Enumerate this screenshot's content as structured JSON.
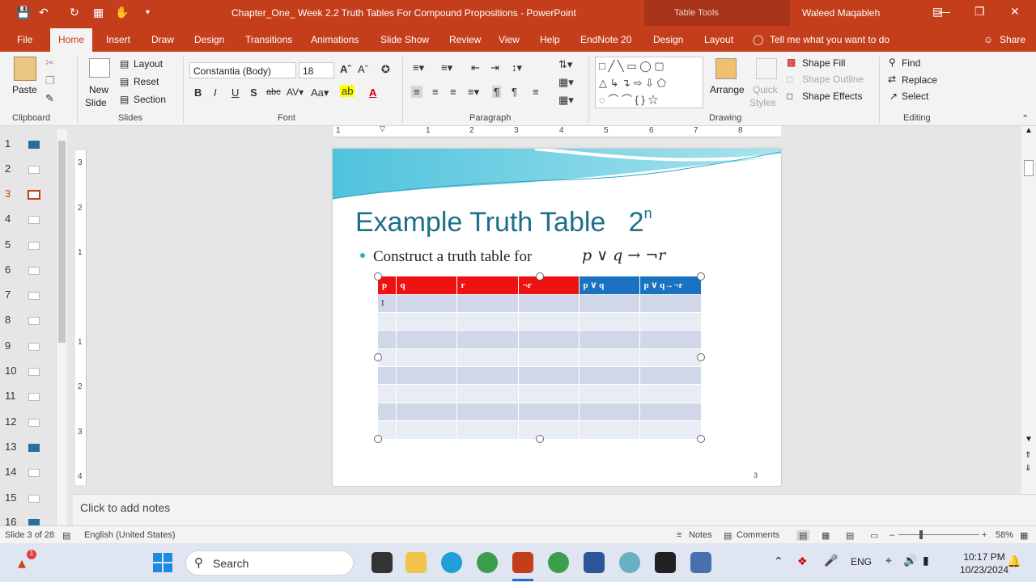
{
  "window": {
    "title": "Chapter_One_ Week 2.2 Truth Tables For Compound Propositions - PowerPoint",
    "context_label": "Table Tools",
    "user": "Waleed Maqableh",
    "share": "Share"
  },
  "tabs": [
    "File",
    "Home",
    "Insert",
    "Draw",
    "Design",
    "Transitions",
    "Animations",
    "Slide Show",
    "Review",
    "View",
    "Help",
    "EndNote 20",
    "Design",
    "Layout"
  ],
  "active_tab": "Home",
  "tell_me": "Tell me what you want to do",
  "ribbon": {
    "clipboard": {
      "paste": "Paste",
      "label": "Clipboard"
    },
    "slides": {
      "new_slide_1": "New",
      "new_slide_2": "Slide",
      "layout": "Layout",
      "reset": "Reset",
      "section": "Section",
      "label": "Slides"
    },
    "font": {
      "name": "Constantia (Body)",
      "size": "18",
      "label": "Font"
    },
    "paragraph": {
      "label": "Paragraph"
    },
    "drawing": {
      "arrange": "Arrange",
      "quick_1": "Quick",
      "quick_2": "Styles",
      "shape_fill": "Shape Fill",
      "shape_outline": "Shape Outline",
      "shape_effects": "Shape Effects",
      "label": "Drawing"
    },
    "editing": {
      "find": "Find",
      "replace": "Replace",
      "select": "Select",
      "label": "Editing"
    }
  },
  "thumbnails": [
    "1",
    "2",
    "3",
    "4",
    "5",
    "6",
    "7",
    "8",
    "9",
    "10",
    "11",
    "12",
    "13",
    "14",
    "15",
    "16"
  ],
  "active_slide": "3",
  "ruler": {
    "h_ticks": [
      "1",
      "1",
      "2",
      "3",
      "4",
      "5",
      "6",
      "7",
      "8"
    ],
    "v_ticks": [
      "3",
      "2",
      "1",
      "1",
      "2",
      "3",
      "4"
    ]
  },
  "slide": {
    "title": "Example Truth Table",
    "title_power": "2",
    "title_exp": "n",
    "bullet": "Construct a truth table for",
    "formula": "p ∨ q → ¬r",
    "number": "3",
    "table": {
      "headers": [
        "p",
        "q",
        "r",
        "¬r",
        "p ∨ q",
        "p ∨ q→¬r"
      ],
      "rows": [
        [
          "1",
          "",
          "",
          "",
          "",
          ""
        ],
        [
          "",
          "",
          "",
          "",
          "",
          ""
        ],
        [
          "",
          "",
          "",
          "",
          "",
          ""
        ],
        [
          "",
          "",
          "",
          "",
          "",
          ""
        ],
        [
          "",
          "",
          "",
          "",
          "",
          ""
        ],
        [
          "",
          "",
          "",
          "",
          "",
          ""
        ],
        [
          "",
          "",
          "",
          "",
          "",
          ""
        ],
        [
          "",
          "",
          "",
          "",
          "",
          ""
        ]
      ]
    }
  },
  "notes_placeholder": "Click to add notes",
  "status": {
    "slide_of": "Slide 3 of 28",
    "language": "English (United States)",
    "notes": "Notes",
    "comments": "Comments",
    "zoom": "58%"
  },
  "taskbar": {
    "search": "Search",
    "lang": "ENG",
    "time": "10:17 PM",
    "date": "10/23/2024"
  },
  "colors": {
    "accent": "#c43e1c",
    "table_red": "#ee1111",
    "table_blue": "#1a72c0",
    "title_teal": "#1e6f8a"
  }
}
